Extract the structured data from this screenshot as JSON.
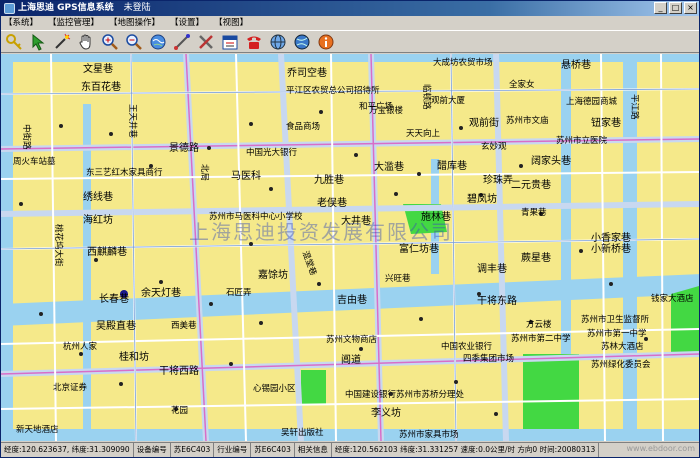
{
  "window": {
    "title": "上海思迪 GPS信息系统",
    "login_status": "未登陆"
  },
  "menu": [
    {
      "label": "【系统】"
    },
    {
      "label": "【监控管理】"
    },
    {
      "label": "【地图操作】"
    },
    {
      "label": "【设置】"
    },
    {
      "label": "【视图】"
    }
  ],
  "toolbar_icons": [
    "key-icon",
    "pointer-icon",
    "magic-wand-icon",
    "pan-hand-icon",
    "zoom-in-icon",
    "zoom-out-icon",
    "refresh-globe-icon",
    "measure-icon",
    "tools-icon",
    "calendar-icon",
    "phone-icon",
    "globe-icon",
    "web-icon",
    "info-icon"
  ],
  "watermark": "上海思迪投资发展有限公司",
  "site_watermark": "www.ebdoor.com",
  "status": {
    "lon_lat": "经度:120.623637, 纬度:31.309090",
    "device_label": "设备编号",
    "device": "苏E6C403",
    "trade_label": "行业编号",
    "trade": "苏E6C403",
    "related_label": "相关信息",
    "related": "经度:120.562103 纬度:31.331257 速度:0.0公里/时 方向0 时间:20080313"
  },
  "map_labels": {
    "l1": "文星巷",
    "l2": "东百花巷",
    "l3": "王天井巷",
    "l4": "中街路",
    "l5": "景德路",
    "l6": "周火车站墓",
    "l7": "东三艺红木家具商行",
    "l8": "绣线巷",
    "l9": "海红坊",
    "l10": "桃花坞大街",
    "l11": "西麒麟巷",
    "l12": "长春巷",
    "l13": "吴殿直巷",
    "l14": "桂和坊",
    "l15": "杭州人家",
    "l16": "北京证券",
    "l17": "新天地酒店",
    "l18": "花园",
    "l19": "乔司空巷",
    "l20": "平江区农贸总公司招待所",
    "l21": "和平广场",
    "l22": "万宝银楼",
    "l23": "食品商场",
    "l24": "中国光大银行",
    "l25": "马医科",
    "l26": "苏州市马医科中心小学校",
    "l27": "嘉馀坊",
    "l28": "石匠弄",
    "l29": "西美巷",
    "l30": "余天灯巷",
    "l31": "北局",
    "l32": "混堂巷",
    "l33": "九胜巷",
    "l34": "大滥巷",
    "l35": "老俣巷",
    "l36": "大井巷",
    "l37": "富仁坊巷",
    "l38": "兴旺巷",
    "l39": "吉由巷",
    "l40": "干将东路",
    "l41": "苏州文物商店",
    "l42": "阊道",
    "l43": "干将西路",
    "l44": "心锡园小区",
    "l45": "中国建设银行苏州市苏桥分理处",
    "l46": "李义坊",
    "l47": "苏州市家具市场",
    "l48": "吴轩出版社",
    "l49": "观前街",
    "l50": "玄妙观",
    "l51": "天天向上",
    "l52": "醋库巷",
    "l53": "阔家头巷",
    "l54": "珍珠弄",
    "l55": "碧凤坊",
    "l56": "施林巷",
    "l57": "青果巷",
    "l58": "蕨星巷",
    "l59": "调丰巷",
    "l60": "小新桥巷",
    "l61": "大成坊农贸市场",
    "l62": "上海德园商城",
    "l63": "苏州市卫生监督所",
    "l64": "苏州市第一中学",
    "l65": "苏州绿化委员会",
    "l66": "钮家巷",
    "l67": "悬桥巷",
    "l68": "临顿路",
    "l69": "平江路",
    "l70": "钱家大酒店",
    "l71": "苏州市立医院",
    "l72": "苏林大酒店",
    "l73": "四季集团市场",
    "l74": "中国农业银行",
    "l75": "苏州市第二中学",
    "l76": "方云楼",
    "l77": "全家女",
    "l78": "小香家巷",
    "l79": "观前大厦",
    "l80": "二元贵巷",
    "l81": "苏州市文庙"
  }
}
